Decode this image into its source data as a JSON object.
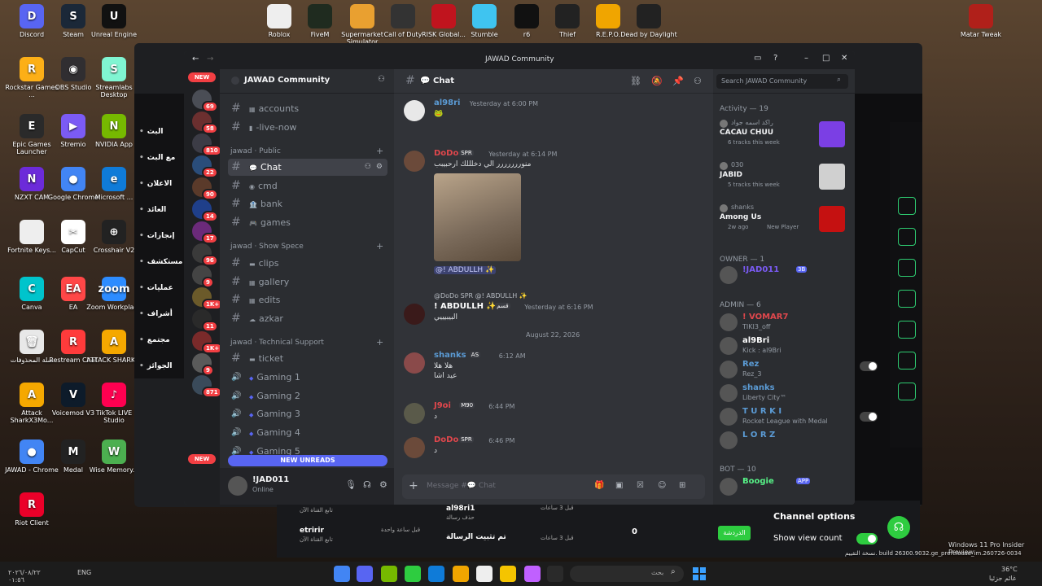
{
  "desktop_icons": [
    {
      "label": "Discord",
      "color": "#5865f2",
      "glyph": "D"
    },
    {
      "label": "Steam",
      "color": "#1b2838",
      "glyph": "S"
    },
    {
      "label": "Unreal Engine",
      "color": "#111111",
      "glyph": "U"
    },
    {
      "label": "Rockstar Games ...",
      "color": "#fcaf17",
      "glyph": "R"
    },
    {
      "label": "OBS Studio",
      "color": "#302e31",
      "glyph": "◉"
    },
    {
      "label": "Streamlabs Desktop",
      "color": "#80f5d2",
      "glyph": "S"
    },
    {
      "label": "Epic Games Launcher",
      "color": "#2a2a2a",
      "glyph": "E"
    },
    {
      "label": "Stremio",
      "color": "#7b5bf5",
      "glyph": "▶"
    },
    {
      "label": "NVIDIA App",
      "color": "#76b900",
      "glyph": "N"
    },
    {
      "label": "NZXT CAM",
      "color": "#6c2bd9",
      "glyph": "N"
    },
    {
      "label": "Google Chrome",
      "color": "#4285f4",
      "glyph": "●"
    },
    {
      "label": "Microsoft ...",
      "color": "#0f7bd8",
      "glyph": "e"
    },
    {
      "label": "Fortnite Keys...",
      "color": "#eeeeee",
      "glyph": ""
    },
    {
      "label": "CapCut",
      "color": "#ffffff",
      "glyph": "✂"
    },
    {
      "label": "Crosshair V2",
      "color": "#222222",
      "glyph": "⊕"
    },
    {
      "label": "Canva",
      "color": "#00c4cc",
      "glyph": "C"
    },
    {
      "label": "EA",
      "color": "#ff4747",
      "glyph": "EA"
    },
    {
      "label": "Zoom Workplace",
      "color": "#2d8cff",
      "glyph": "zoom"
    },
    {
      "label": "سلة المحذوفات",
      "color": "#e8e8e8",
      "glyph": "🗑"
    },
    {
      "label": "Restream Chat",
      "color": "#ff3b3b",
      "glyph": "R"
    },
    {
      "label": "ATTACK SHARK...",
      "color": "#f5a800",
      "glyph": "A"
    },
    {
      "label": "Attack SharkX3Mo...",
      "color": "#f5a800",
      "glyph": "A"
    },
    {
      "label": "Voicemod V3",
      "color": "#0d1b2a",
      "glyph": "V"
    },
    {
      "label": "TikTok LIVE Studio",
      "color": "#ff0050",
      "glyph": "♪"
    },
    {
      "label": "JAWAD - Chrome",
      "color": "#4285f4",
      "glyph": "●"
    },
    {
      "label": "Medal",
      "color": "#222222",
      "glyph": "M"
    },
    {
      "label": "Wise Memory...",
      "color": "#4caf50",
      "glyph": "W"
    },
    {
      "label": "Riot Client",
      "color": "#eb0029",
      "glyph": "R"
    }
  ],
  "top_icons": [
    {
      "label": "Roblox",
      "color": "#eeeeee"
    },
    {
      "label": "FiveM",
      "color": "#1f2b1f"
    },
    {
      "label": "Supermarket Simulator",
      "color": "#e9a030"
    },
    {
      "label": "Call of Duty",
      "color": "#333333"
    },
    {
      "label": "RISK Global...",
      "color": "#c0141e"
    },
    {
      "label": "Stumble",
      "color": "#3fc4f0"
    },
    {
      "label": "r6",
      "color": "#111111"
    },
    {
      "label": "Thief",
      "color": "#222222"
    },
    {
      "label": "R.E.P.O.",
      "color": "#f0a500"
    },
    {
      "label": "Dead by Daylight",
      "color": "#222222"
    },
    {
      "label": "Matar Tweak",
      "color": "#b0201a"
    }
  ],
  "window": {
    "title": "JAWAD Community"
  },
  "server": {
    "name": "JAWAD Community",
    "new_label": "NEW",
    "new_unreads": "NEW UNREADS"
  },
  "server_badges": [
    "69",
    "58",
    "810",
    "22",
    "90",
    "14",
    "17",
    "96",
    "9",
    "1K+",
    "11",
    "1K+",
    "9",
    "871"
  ],
  "channels": [
    {
      "name": "accounts",
      "emoji": "▦"
    },
    {
      "name": "-live-now",
      "emoji": "▮"
    }
  ],
  "categories": {
    "public": "jawad · Public",
    "showspace": "jawad · Show Spece",
    "support": "jawad · Technical Support"
  },
  "public_channels": [
    {
      "name": "Chat",
      "emoji": "💬"
    },
    {
      "name": "cmd",
      "emoji": "◉"
    },
    {
      "name": "bank",
      "emoji": "🏦"
    },
    {
      "name": "games",
      "emoji": "🎮"
    }
  ],
  "showspace_channels": [
    {
      "name": "clips",
      "emoji": "▬"
    },
    {
      "name": "gallery",
      "emoji": "▦"
    },
    {
      "name": "edits",
      "emoji": "▦"
    },
    {
      "name": "azkar",
      "emoji": "☁"
    }
  ],
  "support_channels": [
    {
      "name": "ticket",
      "emoji": "▬"
    },
    {
      "name": "Gaming 1",
      "emoji": "◆"
    },
    {
      "name": "Gaming 2",
      "emoji": "◆"
    },
    {
      "name": "Gaming 3",
      "emoji": "◆"
    },
    {
      "name": "Gaming 4",
      "emoji": "◆"
    },
    {
      "name": "Gaming 5",
      "emoji": "◆"
    }
  ],
  "user": {
    "name": "!JAD011",
    "status": "Online"
  },
  "chat": {
    "channel": "Chat",
    "search_placeholder": "Search JAWAD Community",
    "input_placeholder": "Message #💬 Chat",
    "date_divider": "August 22, 2026",
    "messages": [
      {
        "name": "al98ri",
        "time": "Yesterday at 6:00 PM",
        "text": "🐸",
        "color": "#5b9bd5"
      },
      {
        "name": "DoDo",
        "tag": "SPR",
        "time": "Yesterday at 6:14 PM",
        "text": "منوررررررر الي دخلللك ارحبيبب",
        "color": "#e0474c"
      },
      {
        "name": "! ABDULLH ✨",
        "tag": "قسم",
        "time": "Yesterday at 6:16 PM",
        "text": "البيبيييي",
        "color": "#ffffff",
        "reply": "@DoDo SPR @! ABDULLH ✨"
      },
      {
        "name": "shanks",
        "tag": "AS",
        "time": "6:12 AM",
        "text": "هلا هلا",
        "text2": "عيد اشا",
        "color": "#5b9bd5"
      },
      {
        "name": "J9oi",
        "tag": "M90",
        "time": "6:44 PM",
        "text": "د",
        "color": "#e0474c"
      },
      {
        "name": "DoDo",
        "tag": "SPR",
        "time": "6:46 PM",
        "text": "د",
        "color": "#e0474c"
      }
    ],
    "mention": "@! ABDULLH ✨"
  },
  "members": {
    "activity_header": "Activity — 19",
    "activities": [
      {
        "user": "راكد اسمه جواد",
        "title": "CACAU CHUU",
        "sub": "6 tracks this week",
        "color": "#7b3fe4"
      },
      {
        "user": "030",
        "title": "JABID",
        "sub": "5 tracks this week",
        "color": "#d0d0d0"
      },
      {
        "user": "shanks",
        "title": "Among Us",
        "sub": "2w ago",
        "sub2": "New Player",
        "color": "#c51111"
      }
    ],
    "owner_header": "OWNER — 1",
    "owner": [
      {
        "name": "!JAD011",
        "tag": "3B",
        "color": "#7b5bf5"
      }
    ],
    "admin_header": "ADMIN — 6",
    "admins": [
      {
        "name": "! VOMAR7",
        "status": "TIKI3_off",
        "color": "#e0474c"
      },
      {
        "name": "al9Bri",
        "status": "Kick : al9Bri",
        "color": "#ffffff"
      },
      {
        "name": "Rez",
        "status": "Rez_3",
        "color": "#5b9bd5"
      },
      {
        "name": "shanks",
        "status": "Liberty City™",
        "color": "#5b9bd5"
      },
      {
        "name": "T U R K I",
        "status": "Rocket League with Medal",
        "color": "#5b9bd5"
      },
      {
        "name": "L O R Z",
        "status": "",
        "color": "#5b9bd5"
      }
    ],
    "bot_header": "BOT — 10",
    "bots": [
      {
        "name": "Boogie",
        "tag": "APP",
        "color": "#57f287"
      }
    ]
  },
  "bg_app": {
    "channel_options": "Channel options",
    "show_view_count": "Show view count",
    "item1": "al98ri1",
    "item1_sub": "حذف رسالة",
    "item2": "تم تثبيت الرسالة",
    "time1": "قبل 3 ساعات",
    "time2": "قبل 3 ساعات",
    "name3": "etririr",
    "sub3": "تابع القناة الآن",
    "time3": "قبل ساعة واحدة",
    "arabic_top": "تابع القناة الآن",
    "count": "0",
    "green_btn": "الدردشة",
    "sidebar_items": [
      "البث",
      "مع البث",
      "الاعلان",
      "العائد",
      "إنجازات",
      "مستكشف",
      "عمليات",
      "أشراف",
      "مجتمع",
      "الجوائز"
    ]
  },
  "taskbar": {
    "left_text": "ENG",
    "search": "بحث",
    "date": "٢٠٢٦/٠٨/٢٢",
    "time": "٠١:٥٦",
    "weather": "36°C",
    "weather_sub": "غائم جزئيا",
    "watermark1": "Windows 11 Pro Insider Preview",
    "watermark2": "نسخة التقييم. build 26300.9032.ge_prerelease_im.260726-0034"
  }
}
